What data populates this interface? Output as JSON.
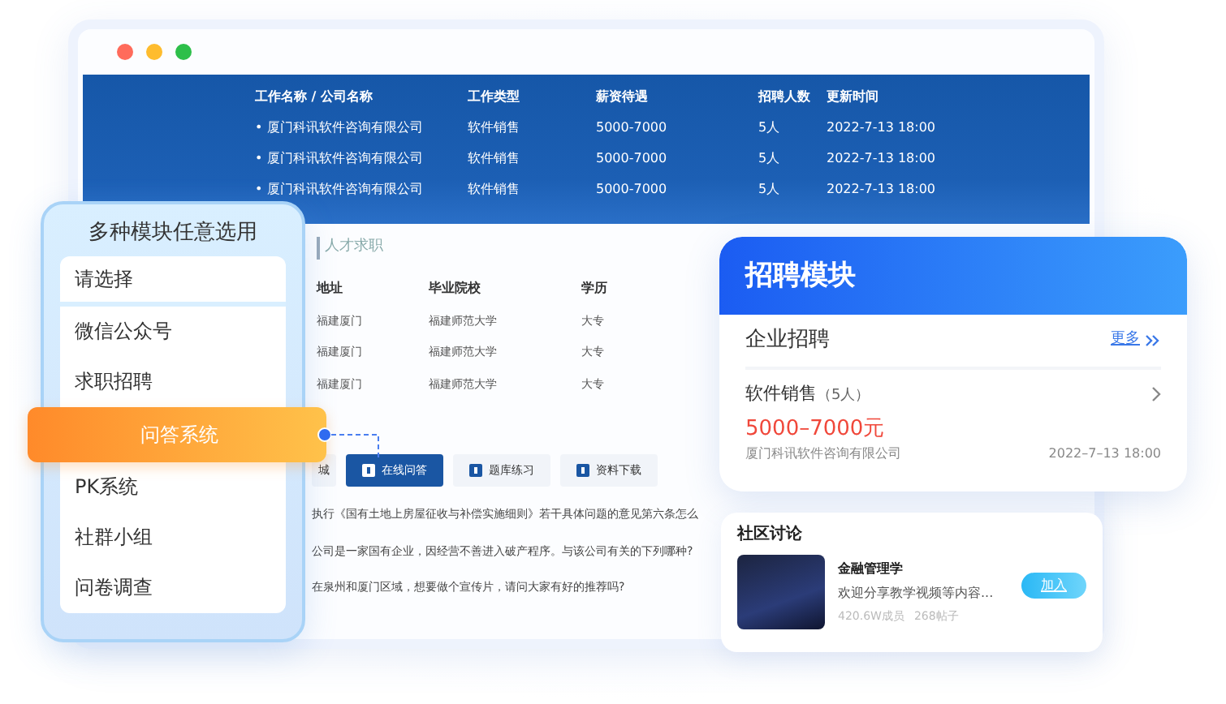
{
  "window": {
    "traffic_lights": [
      {
        "color": "#ff6b5b"
      },
      {
        "color": "#febc2e"
      },
      {
        "color": "#2dbf4a"
      }
    ]
  },
  "job_table": {
    "columns": [
      "工作名称 / 公司名称",
      "工作类型",
      "薪资待遇",
      "招聘人数",
      "更新时间"
    ],
    "rows": [
      [
        "• 厦门科讯软件咨询有限公司",
        "软件销售",
        "5000-7000",
        "5人",
        "2022-7-13 18:00"
      ],
      [
        "• 厦门科讯软件咨询有限公司",
        "软件销售",
        "5000-7000",
        "5人",
        "2022-7-13 18:00"
      ],
      [
        "• 厦门科讯软件咨询有限公司",
        "软件销售",
        "5000-7000",
        "5人",
        "2022-7-13 18:00"
      ]
    ]
  },
  "talent_section": {
    "title": "人才求职",
    "columns": [
      "地址",
      "毕业院校",
      "学历"
    ],
    "rows": [
      [
        "福建厦门",
        "福建师范大学",
        "大专"
      ],
      [
        "福建厦门",
        "福建师范大学",
        "大专"
      ],
      [
        "福建厦门",
        "福建师范大学",
        "大专"
      ]
    ]
  },
  "tabs": [
    {
      "label": "城",
      "selected": false,
      "icon": false
    },
    {
      "label": "在线问答",
      "selected": true,
      "icon": true
    },
    {
      "label": "题库练习",
      "selected": false,
      "icon": true
    },
    {
      "label": "资料下载",
      "selected": false,
      "icon": true
    }
  ],
  "questions": [
    "执行《国有土地上房屋征收与补偿实施细则》若干具体问题的意见第六条怎么",
    "公司是一家国有企业，因经营不善进入破产程序。与该公司有关的下列哪种?",
    "在泉州和厦门区域，想要做个宣传片，请问大家有好的推荐吗?"
  ],
  "module_panel": {
    "title": "多种模块任意选用",
    "items": [
      {
        "label": "请选择",
        "selected": false
      },
      {
        "label": "微信公众号",
        "selected": false
      },
      {
        "label": "求职招聘",
        "selected": false
      },
      {
        "label": "问答系统",
        "selected": true
      },
      {
        "label": "PK系统",
        "selected": false
      },
      {
        "label": "社群小组",
        "selected": false
      },
      {
        "label": "问卷调查",
        "selected": false
      }
    ]
  },
  "recruit_card": {
    "title": "招聘模块",
    "section": "企业招聘",
    "more": "更多",
    "job": "软件销售",
    "count": "（5人）",
    "salary": "5000–7000元",
    "company": "厦门科讯软件咨询有限公司",
    "time": "2022–7–13 18:00"
  },
  "community_card": {
    "title": "社区讨论",
    "group": {
      "name": "金融管理学",
      "description": "欢迎分享教学视频等内容...",
      "members": "420.6W成员",
      "posts": "268帖子",
      "join": "加入"
    }
  }
}
